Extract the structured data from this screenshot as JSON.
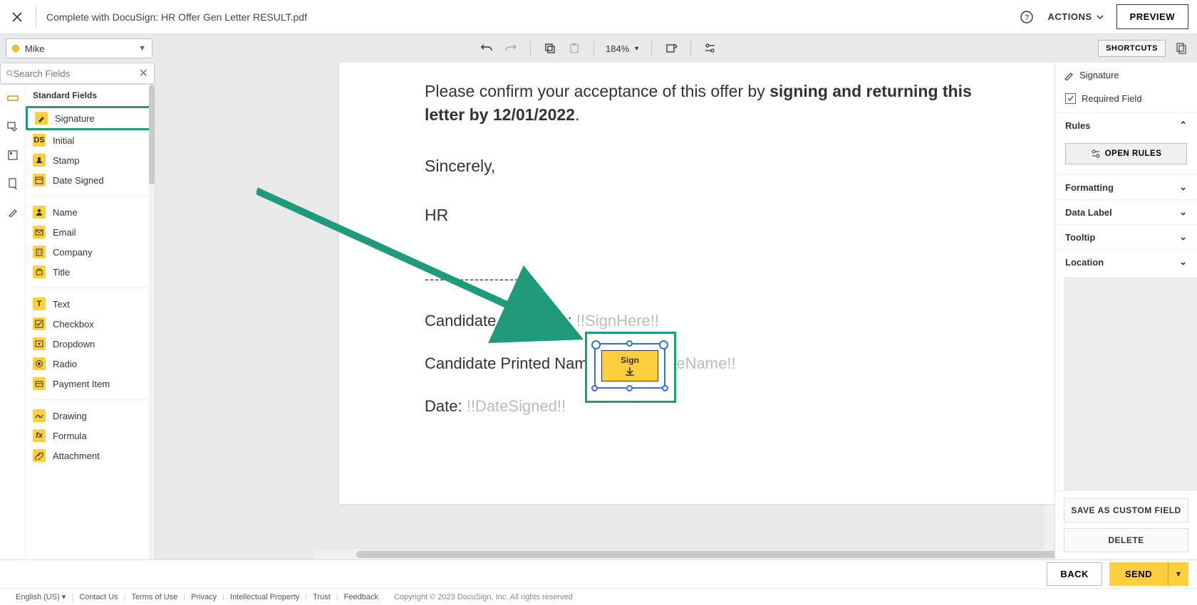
{
  "header": {
    "doc_title": "Complete with DocuSign: HR Offer Gen Letter RESULT.pdf",
    "actions_label": "ACTIONS",
    "preview_label": "PREVIEW"
  },
  "toolbar": {
    "recipient_name": "Mike",
    "zoom_label": "184%",
    "shortcuts_label": "SHORTCUTS"
  },
  "search": {
    "placeholder": "Search Fields"
  },
  "fields": {
    "section_label": "Standard Fields",
    "signature": "Signature",
    "initial": "Initial",
    "stamp": "Stamp",
    "date_signed": "Date Signed",
    "name": "Name",
    "email": "Email",
    "company": "Company",
    "title": "Title",
    "text": "Text",
    "checkbox": "Checkbox",
    "dropdown": "Dropdown",
    "radio": "Radio",
    "payment": "Payment Item",
    "drawing": "Drawing",
    "formula": "Formula",
    "attachment": "Attachment"
  },
  "document": {
    "lead_pre": "Please confirm your acceptance of this offer by ",
    "lead_bold": "signing and returning this letter by 12/01/2022",
    "lead_post": ".",
    "sincerely": "Sincerely,",
    "hr": "HR",
    "dashes": "----------------------",
    "row_sig_label": "Candidate Signature: ",
    "row_sig_ph": "!!SignHere!!",
    "row_name_label": "Candidate Printed Name: ",
    "row_name_ph": "!!CandidateName!!",
    "row_date_label": "Date: ",
    "row_date_ph": "!!DateSigned!!",
    "sign_widget_label": "Sign"
  },
  "right_panel": {
    "title": "Signature",
    "required_label": "Required Field",
    "rules_label": "Rules",
    "open_rules_label": "OPEN RULES",
    "formatting": "Formatting",
    "data_label": "Data Label",
    "tooltip": "Tooltip",
    "location": "Location",
    "save_custom": "SAVE AS CUSTOM FIELD",
    "delete": "DELETE"
  },
  "bottom": {
    "back": "BACK",
    "send": "SEND"
  },
  "footer": {
    "lang": "English (US)",
    "links": [
      "Contact Us",
      "Terms of Use",
      "Privacy",
      "Intellectual Property",
      "Trust",
      "Feedback"
    ],
    "copyright": "Copyright © 2023 DocuSign, Inc. All rights reserved"
  }
}
